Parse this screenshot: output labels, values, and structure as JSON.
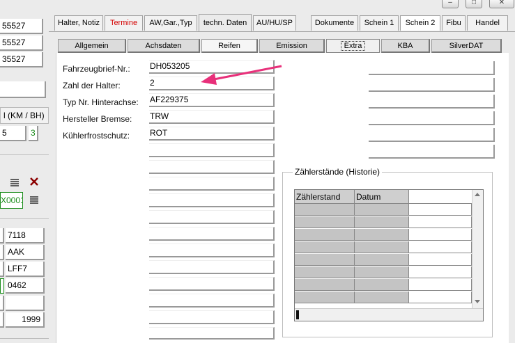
{
  "window_buttons": [
    "–",
    "□",
    "✕"
  ],
  "left": {
    "top_values": [
      "55527",
      "55527",
      "35527"
    ],
    "section_header": "l (KM / BH)",
    "km_value": "5",
    "km_small": "3",
    "code_value": "X0001",
    "fields": [
      "7118",
      "AAK",
      "LFF7",
      "0462",
      "",
      "1999"
    ]
  },
  "tabs_main": [
    "Halter, Notiz",
    "Termine",
    "AW,Gar.,Typ",
    "techn. Daten",
    "AU/HU/SP",
    "Dokumente",
    "Schein 1",
    "Schein 2",
    "Fibu",
    "Handel"
  ],
  "tabs_main_active": "techn. Daten",
  "tabs_sub": [
    "Allgemein",
    "Achsdaten",
    "Reifen",
    "Emission",
    "Extra",
    "KBA",
    "SilverDAT"
  ],
  "tabs_sub_active": "Extra",
  "form": {
    "rows": [
      {
        "label": "Fahrzeugbrief-Nr.:",
        "value": "DH053205"
      },
      {
        "label": "Zahl der Halter:",
        "value": "2"
      },
      {
        "label": "Typ Nr. Hinterachse:",
        "value": "AF229375"
      },
      {
        "label": "Hersteller Bremse:",
        "value": "TRW"
      },
      {
        "label": "Kühlerfrostschutz:",
        "value": "ROT"
      }
    ]
  },
  "history": {
    "title": "Zählerstände (Historie)",
    "columns": [
      "Zählerstand",
      "Datum"
    ]
  },
  "colors": {
    "arrow": "#e8307a",
    "termine": "#d40000",
    "delete_icon": "#8b0000",
    "green_value": "#1a8c1a"
  }
}
